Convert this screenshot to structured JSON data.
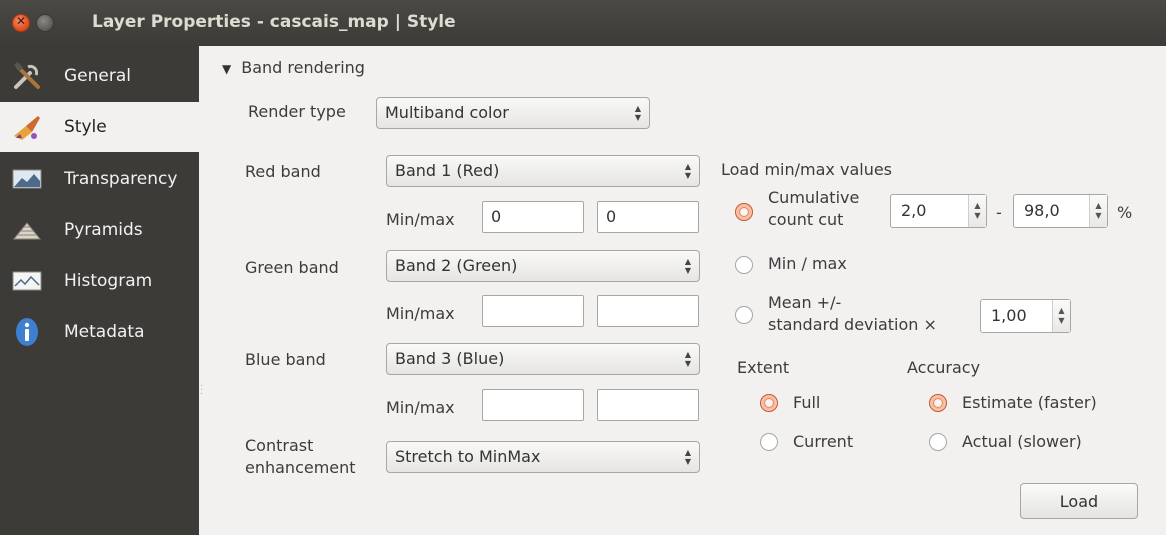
{
  "window": {
    "title": "Layer Properties - cascais_map | Style"
  },
  "sidebar": {
    "items": [
      {
        "label": "General",
        "icon": "tools-icon"
      },
      {
        "label": "Style",
        "icon": "paintbrush-icon"
      },
      {
        "label": "Transparency",
        "icon": "transparency-icon"
      },
      {
        "label": "Pyramids",
        "icon": "pyramids-icon"
      },
      {
        "label": "Histogram",
        "icon": "histogram-icon"
      },
      {
        "label": "Metadata",
        "icon": "info-icon"
      }
    ],
    "active": "Style"
  },
  "band_rendering": {
    "header": "Band rendering",
    "render_type_label": "Render type",
    "render_type_value": "Multiband color",
    "red_band_label": "Red band",
    "red_band_value": "Band 1 (Red)",
    "green_band_label": "Green band",
    "green_band_value": "Band 2 (Green)",
    "blue_band_label": "Blue band",
    "blue_band_value": "Band 3 (Blue)",
    "minmax_label": "Min/max",
    "red_min": "0",
    "red_max": "0",
    "green_min": "",
    "green_max": "",
    "blue_min": "",
    "blue_max": "",
    "contrast_label_1": "Contrast",
    "contrast_label_2": "enhancement",
    "contrast_value": "Stretch to MinMax"
  },
  "load_minmax": {
    "title": "Load min/max values",
    "cumulative_label_1": "Cumulative",
    "cumulative_label_2": "count cut",
    "cumulative_low": "2,0",
    "cumulative_dash": "-",
    "cumulative_high": "98,0",
    "percent": "%",
    "minmax_label": "Min / max",
    "mean_label_1": "Mean +/-",
    "mean_label_2": "standard deviation ×",
    "stddev_value": "1,00",
    "selected": "cumulative",
    "extent_label": "Extent",
    "extent_full": "Full",
    "extent_current": "Current",
    "extent_selected": "Full",
    "accuracy_label": "Accuracy",
    "accuracy_estimate": "Estimate (faster)",
    "accuracy_actual": "Actual (slower)",
    "accuracy_selected": "Estimate (faster)",
    "load_button": "Load"
  },
  "colors": {
    "accent": "#e05a24",
    "sidebar_bg": "#3c3b37",
    "titlebar_bg": "#3c3b37"
  }
}
